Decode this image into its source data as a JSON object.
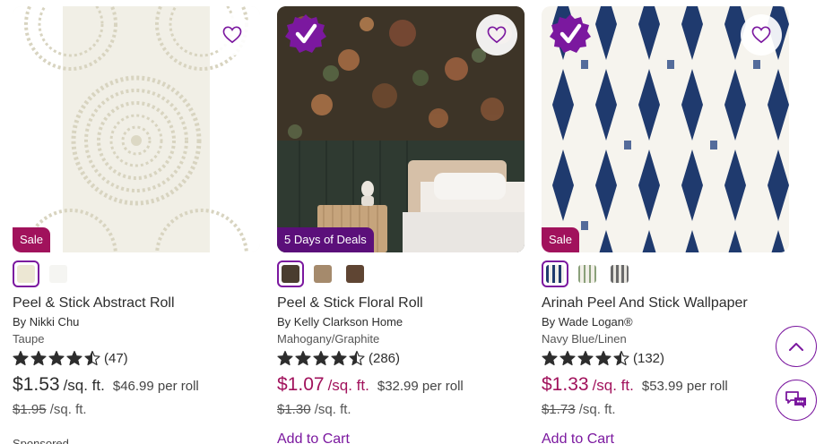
{
  "colors": {
    "brand_purple": "#7b189f",
    "sale_red": "#a1125c",
    "deal_purple": "#5b0f7a"
  },
  "products": [
    {
      "badge": "Sale",
      "badge_type": "sale",
      "verified": false,
      "name": "Peel & Stick Abstract Roll",
      "brand": "By Nikki Chu",
      "variant": "Taupe",
      "rating": 4.5,
      "review_count": "(47)",
      "price": "$1.53",
      "unit": "/sq. ft.",
      "per_roll": "$46.99 per roll",
      "was_price": "$1.95",
      "was_unit": "/sq. ft.",
      "price_on_sale": false,
      "footer": "Sponsored",
      "footer_type": "sponsored",
      "swatches": [
        "cream-circles",
        "white-pattern"
      ]
    },
    {
      "badge": "5 Days of Deals",
      "badge_type": "deal",
      "verified": true,
      "name": "Peel & Stick Floral Roll",
      "brand": "By Kelly Clarkson Home",
      "variant": "Mahogany/Graphite",
      "rating": 4.5,
      "review_count": "(286)",
      "price": "$1.07",
      "unit": "/sq. ft.",
      "per_roll": "$32.99 per roll",
      "was_price": "$1.30",
      "was_unit": "/sq. ft.",
      "price_on_sale": true,
      "footer": "Add to Cart",
      "footer_type": "cart",
      "swatches": [
        "dark-floral",
        "tan-floral",
        "brown-floral"
      ]
    },
    {
      "badge": "Sale",
      "badge_type": "sale",
      "verified": true,
      "name": "Arinah Peel And Stick Wallpaper",
      "brand": "By Wade Logan®",
      "variant": "Navy Blue/Linen",
      "rating": 4.5,
      "review_count": "(132)",
      "price": "$1.33",
      "unit": "/sq. ft.",
      "per_roll": "$53.99 per roll",
      "was_price": "$1.73",
      "was_unit": "/sq. ft.",
      "price_on_sale": true,
      "footer": "Add to Cart",
      "footer_type": "cart",
      "swatches": [
        "navy-ikat",
        "green-ikat",
        "grey-ikat"
      ]
    }
  ],
  "icons": {
    "favorite": "heart-outline-icon",
    "verified": "verified-check-badge-icon",
    "scroll_top": "chevron-up-icon",
    "chat": "chat-bubbles-icon"
  }
}
